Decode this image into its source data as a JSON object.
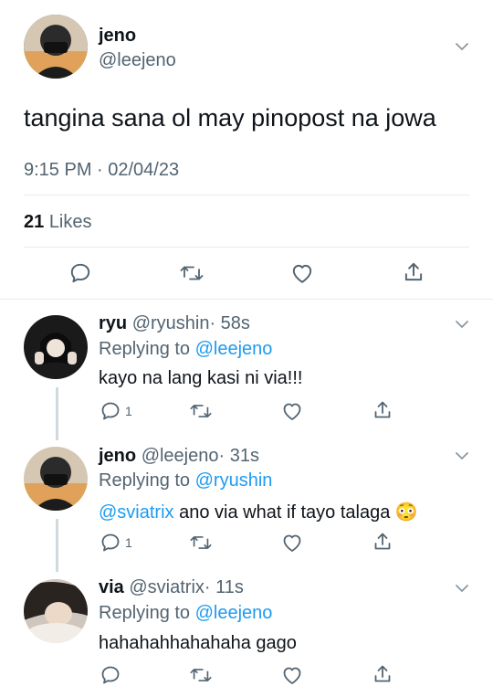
{
  "tweet": {
    "name": "jeno",
    "handle": "@leejeno",
    "text": "tangina sana ol may pinopost na jowa",
    "timestamp": "9:15 PM · 02/04/23",
    "likes_count": "21",
    "likes_label": "Likes"
  },
  "replies": [
    {
      "name": "ryu",
      "handle": "@ryushin",
      "time": "· 58s",
      "replying_prefix": "Replying to",
      "replying_to": "@leejeno",
      "mention": "",
      "text": "kayo na lang kasi ni via!!!",
      "reply_count": "1"
    },
    {
      "name": "jeno",
      "handle": "@leejeno",
      "time": "· 31s",
      "replying_prefix": "Replying to",
      "replying_to": "@ryushin",
      "mention": "@sviatrix",
      "text": " ano via what if tayo talaga",
      "emoji": "😳",
      "reply_count": "1"
    },
    {
      "name": "via",
      "handle": "@sviatrix",
      "time": "· 11s",
      "replying_prefix": "Replying to",
      "replying_to": "@leejeno",
      "mention": "",
      "text": "hahahahhahahaha gago",
      "reply_count": ""
    }
  ],
  "icons": [
    "comment-icon",
    "retweet-icon",
    "like-icon",
    "share-icon",
    "chevron-down-icon"
  ],
  "colors": {
    "accent": "#1d9bf0",
    "muted": "#536471",
    "text": "#0f1419",
    "divider": "#e6ecf0"
  }
}
